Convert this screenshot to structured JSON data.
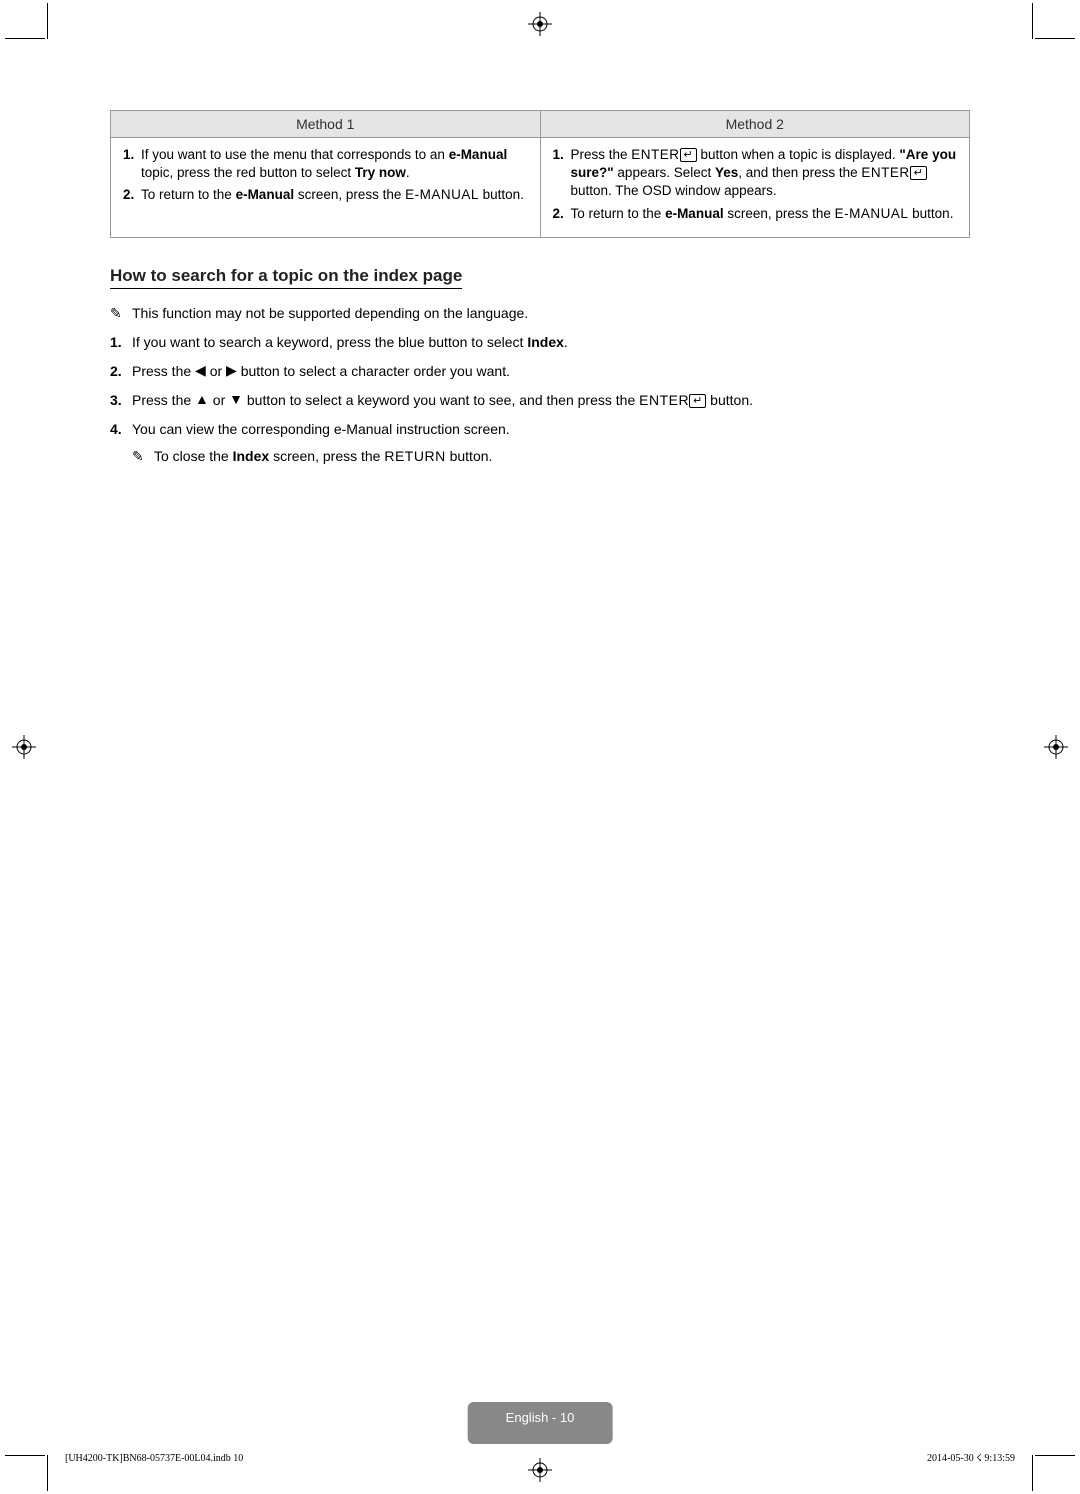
{
  "table": {
    "header1": "Method 1",
    "header2": "Method 2",
    "m1_1_num": "1.",
    "m1_1_a": "If you want to use the menu that corresponds to an ",
    "m1_1_b": "e-Manual",
    "m1_1_c": " topic, press the red button to select ",
    "m1_1_d": "Try now",
    "m1_1_e": ".",
    "m1_2_num": "2.",
    "m1_2_a": "To return to the ",
    "m1_2_b": "e-Manual",
    "m1_2_c": " screen, press the ",
    "m1_2_d": "E-MANUAL",
    "m1_2_e": " button.",
    "m2_1_num": "1.",
    "m2_1_a": "Press the ",
    "m2_1_b": "ENTER",
    "m2_1_c": " button when a topic is displayed. ",
    "m2_1_d": "\"Are you sure?\"",
    "m2_1_e": " appears. Select ",
    "m2_1_f": "Yes",
    "m2_1_g": ", and then press the ",
    "m2_1_h": "ENTER",
    "m2_1_i": " button. The OSD window appears.",
    "m2_2_num": "2.",
    "m2_2_a": "To return to the ",
    "m2_2_b": "e-Manual",
    "m2_2_c": " screen, press the ",
    "m2_2_d": "E-MANUAL",
    "m2_2_e": " button."
  },
  "section_title": "How to search for a topic on the index page",
  "note1": "This function may not be supported depending on the language.",
  "step1_num": "1.",
  "step1_a": "If you want to search a keyword, press the blue button to select ",
  "step1_b": "Index",
  "step1_c": ".",
  "step2_num": "2.",
  "step2_a": "Press the ",
  "step2_b": " or ",
  "step2_c": " button to select a character order you want.",
  "step3_num": "3.",
  "step3_a": "Press the ",
  "step3_b": " or ",
  "step3_c": " button to select a keyword you want to see, and then press the ",
  "step3_d": "ENTER",
  "step3_e": " button.",
  "step4_num": "4.",
  "step4_txt": "You can view the corresponding e-Manual instruction screen.",
  "step4_note_a": "To close the ",
  "step4_note_b": "Index",
  "step4_note_c": " screen, press the ",
  "step4_note_d": "RETURN",
  "step4_note_e": " button.",
  "badge": "English - 10",
  "footer_left": "[UH4200-TK]BN68-05737E-00L04.indb   10",
  "footer_right": "2014-05-30   ☇ 9:13:59",
  "glyphs": {
    "note_icon": "✎",
    "enter_arrow": "↵",
    "left": "◀",
    "right": "▶",
    "up": "▲",
    "down": "▼"
  }
}
